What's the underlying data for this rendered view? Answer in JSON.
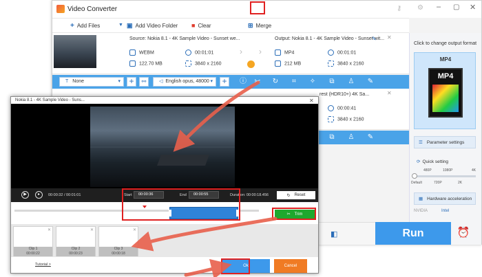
{
  "app": {
    "title": "Video Converter"
  },
  "toolbar": {
    "add_files": "Add Files",
    "add_folder": "Add Video Folder",
    "clear": "Clear",
    "merge": "Merge"
  },
  "file1": {
    "source_title": "Source: Nokia 8.1 - 4K Sample Video - Sunset we...",
    "output_title": "Output: Nokia 8.1 - 4K Sample Video - Sunset wit...",
    "src_format": "WEBM",
    "src_duration": "00:01:01",
    "src_size": "122.70 MB",
    "src_resolution": "3840 x 2160",
    "out_format": "MP4",
    "out_duration": "00:01:01",
    "out_size": "212 MB",
    "out_resolution": "3840 x 2160"
  },
  "file2": {
    "output_title": "rest (HDR10+) 4K Sa...",
    "out_duration": "00:00:41",
    "out_resolution": "3840 x 2160"
  },
  "edit_bar": {
    "subtitle_value": "None",
    "audio_value": "English opus, 48000"
  },
  "right_panel": {
    "format_caption": "Click to change output format",
    "format": "MP4",
    "format_icon_text": "MP4",
    "parameter_settings": "Parameter settings",
    "quick_setting": "Quick setting",
    "ticks_top": [
      "480P",
      "1080P",
      "4K"
    ],
    "ticks_bottom": [
      "Default",
      "720P",
      "2K"
    ],
    "hardware_acceleration": "Hardware acceleration",
    "hw_vendors": [
      "NVIDIA",
      "Intel"
    ]
  },
  "run_label": "Run",
  "dialog": {
    "title": "Nokia 8.1 - 4K Sample Video - Suns...",
    "current_time": "00:00:32",
    "total_time": "00:01:01",
    "start_label": "Start",
    "start_value": "00:00:36",
    "end_label": "End",
    "end_value": "00:00:55",
    "duration_label": "Duration:",
    "duration_value": "00:00:18.456",
    "reset_label": "Reset",
    "trim_label": "Trim",
    "clips": [
      {
        "name": "Clip 1",
        "time": "00:00:22"
      },
      {
        "name": "Clip 2",
        "time": "00:00:23"
      },
      {
        "name": "Clip 3",
        "time": "00:00:18"
      }
    ],
    "tutorial": "Tutorial >",
    "ok": "Ok",
    "cancel": "Cancel"
  },
  "colors": {
    "accent_blue": "#3d99eb",
    "trim_green": "#1fa82e",
    "cancel_orange": "#f07b24",
    "highlight_red": "#e02020"
  }
}
